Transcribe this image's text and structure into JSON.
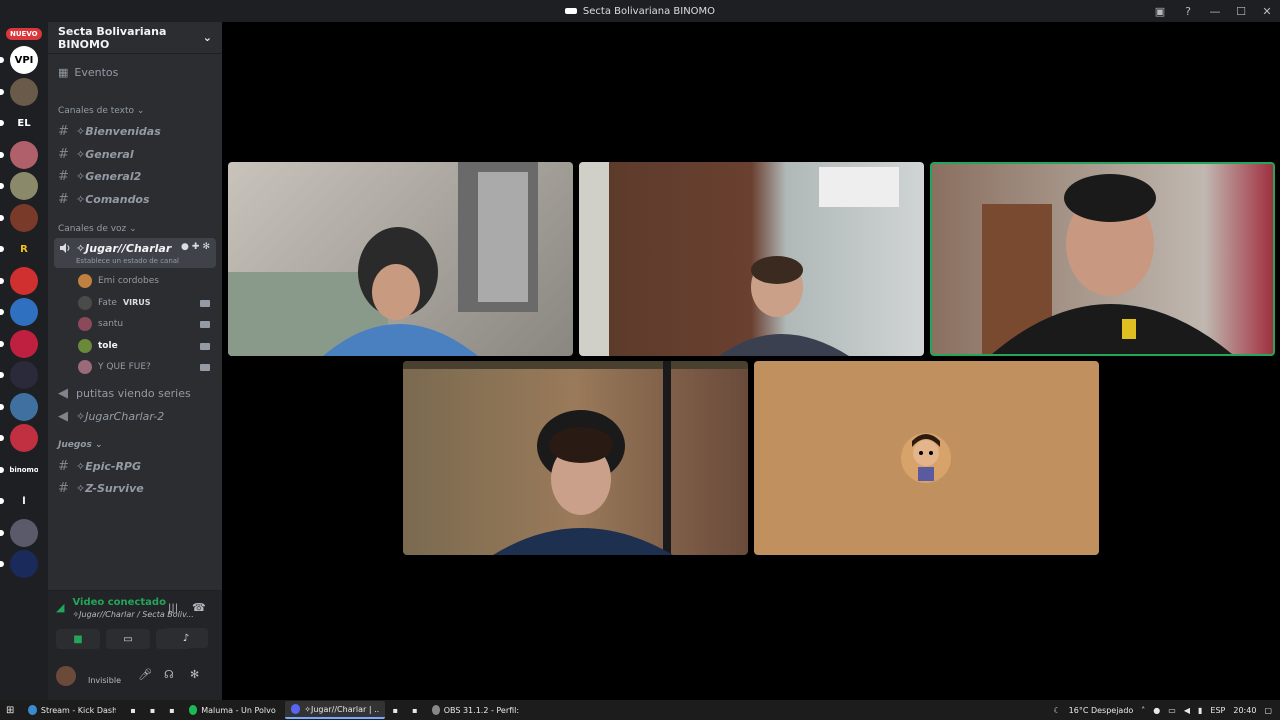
{
  "window": {
    "title": "Secta Bolivariana BINOMO"
  },
  "guilds": {
    "badge": "NUEVO",
    "items": [
      {
        "label": "VPI",
        "bg": "#ffffff",
        "fg": "#000000"
      },
      {
        "label": "",
        "bg": "#6a5a4a"
      },
      {
        "label": "EL",
        "bg": "#1e1f22",
        "fg": "#ffffff"
      },
      {
        "label": "",
        "bg": "#b0606a"
      },
      {
        "label": "",
        "bg": "#8a8a6a"
      },
      {
        "label": "",
        "bg": "#7a3a2a"
      },
      {
        "label": "R",
        "bg": "#1e1f22",
        "fg": "#f0c020"
      },
      {
        "label": "",
        "bg": "#d03030"
      },
      {
        "label": "",
        "bg": "#3070c0"
      },
      {
        "label": "",
        "bg": "#c02040"
      },
      {
        "label": "",
        "bg": "#2a2a3a"
      },
      {
        "label": "",
        "bg": "#4070a0"
      },
      {
        "label": "",
        "bg": "#c03040"
      },
      {
        "label": "binomo",
        "bg": "#1e1f22",
        "fg": "#ffffff"
      },
      {
        "label": "l",
        "bg": "#1e1f22",
        "fg": "#ffffff"
      },
      {
        "label": "",
        "bg": "#5a5a6a"
      },
      {
        "label": "",
        "bg": "#1a2a5a"
      }
    ]
  },
  "server": {
    "name": "Secta Bolivariana BINOMO",
    "events": "Eventos",
    "text_category": "Canales de texto",
    "text_channels": [
      "✧Bienvenidas",
      "✧General",
      "✧General2",
      "✧Comandos"
    ],
    "voice_category": "Canales de voz",
    "active_voice": {
      "name": "✧Jugar//Charlar",
      "status": "Establece un estado de canal"
    },
    "voice_users": [
      {
        "name": "Emi cordobes",
        "color": "#c08040",
        "cam": false
      },
      {
        "name": "Fate",
        "badge": "VIRUS",
        "color": "#4a4a4a",
        "cam": true
      },
      {
        "name": "santu",
        "color": "#8a4a5a",
        "cam": true
      },
      {
        "name": "tole",
        "color": "#6a8a3a",
        "cam": true,
        "bold": true
      },
      {
        "name": "Y QUE FUE?",
        "color": "#9a6a7a",
        "cam": true
      }
    ],
    "other_voice": [
      "putitas viendo series",
      "✧JugarCharlar-2"
    ],
    "games_category": "Juegos",
    "games_channels": [
      "✧Epic-RPG",
      "✧Z-Survive"
    ]
  },
  "voice_panel": {
    "status": "Video conectado",
    "channel": "✧Jugar//Charlar / Secta Boliv..."
  },
  "user_panel": {
    "status": "Invisible"
  },
  "taskbar": {
    "items": [
      {
        "label": "Stream - Kick Dashb...",
        "color": "#3a8ad0",
        "sel": false
      },
      {
        "label": "Maluma - Un Polvo (...",
        "color": "#1db954",
        "sel": false
      },
      {
        "label": "✧Jugar//Charlar | ...",
        "color": "#5865f2",
        "sel": true
      },
      {
        "label": "OBS 31.1.2 - Perfil: ki...",
        "color": "#888888",
        "sel": false
      }
    ],
    "weather": "16°C  Despejado",
    "lang": "ESP",
    "time": "20:40"
  }
}
